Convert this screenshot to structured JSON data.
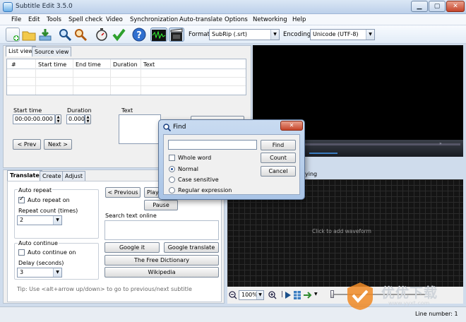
{
  "window": {
    "title": "Subtitle Edit 3.5.0"
  },
  "menu": [
    "File",
    "Edit",
    "Tools",
    "Spell check",
    "Video",
    "Synchronization",
    "Auto-translate",
    "Options",
    "Networking",
    "Help"
  ],
  "toolbar": {
    "format_label": "Format",
    "format_value": "SubRip (.srt)",
    "encoding_label": "Encoding",
    "encoding_value": "Unicode (UTF-8)"
  },
  "list_tabs": [
    "List view",
    "Source view"
  ],
  "grid": {
    "columns": [
      "#",
      "Start time",
      "End time",
      "Duration",
      "Text"
    ]
  },
  "editor": {
    "start_time_label": "Start time",
    "start_time_value": "00:00:00.000",
    "duration_label": "Duration",
    "duration_value": "0.000",
    "text_label": "Text",
    "prev_button": "< Prev",
    "next_button": "Next >"
  },
  "bottom_tabs": [
    "Translate",
    "Create",
    "Adjust"
  ],
  "translate": {
    "auto_repeat_title": "Auto repeat",
    "auto_repeat_on": "Auto repeat on",
    "repeat_count_label": "Repeat count (times)",
    "repeat_count_value": "2",
    "auto_continue_title": "Auto continue",
    "auto_continue_on": "Auto continue on",
    "delay_label": "Delay (seconds)",
    "delay_value": "3",
    "previous_button": "< Previous",
    "play_button": "Play",
    "pause_button": "Pause",
    "search_online_label": "Search text online",
    "google_it": "Google it",
    "google_translate": "Google translate",
    "free_dictionary": "The Free Dictionary",
    "wikipedia": "Wikipedia",
    "tip": "Tip: Use <alt+arrow up/down> to go to previous/next subtitle"
  },
  "waveform": {
    "placeholder": "Click to add waveform",
    "header_partial": "ying",
    "zoom_value": "100%"
  },
  "status": {
    "line_number": "Line number: 1"
  },
  "watermark": {
    "text": "优优下载",
    "url": "www.yyxt.com"
  },
  "find_dialog": {
    "title": "Find",
    "find_button": "Find",
    "count_button": "Count",
    "cancel_button": "Cancel",
    "whole_word": "Whole word",
    "normal": "Normal",
    "case_sensitive": "Case sensitive",
    "regular_expression": "Regular expression"
  },
  "colors": {
    "accent": "#3a7cc0",
    "video_bg": "#000000",
    "waveform_bg": "#141414"
  }
}
